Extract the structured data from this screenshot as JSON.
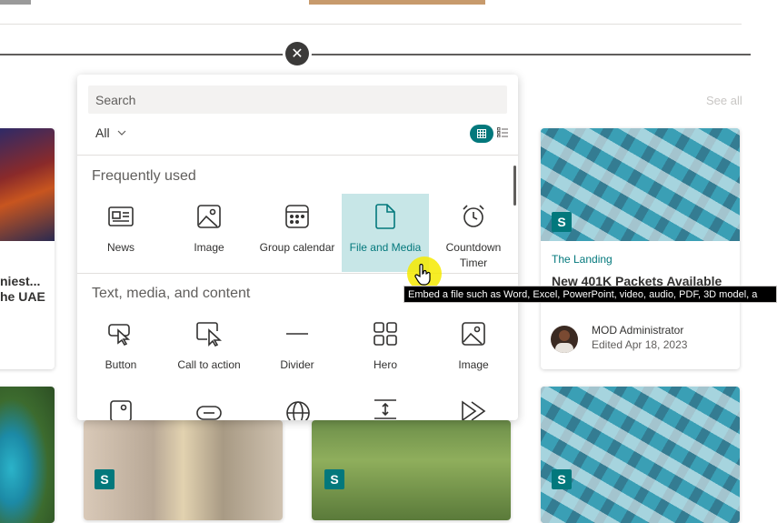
{
  "background": {
    "see_all": "See all",
    "cards": [
      {
        "title_line1": "niest...",
        "title_line2": "he UAE"
      },
      {
        "site": "The Landing",
        "title": "New 401K Packets Available",
        "author": "MOD Administrator",
        "edited": "Edited Apr 18, 2023"
      }
    ],
    "site_badge": "S"
  },
  "panel": {
    "search_placeholder": "Search",
    "filter_label": "All",
    "sections": [
      {
        "title": "Frequently used",
        "items": [
          {
            "label": "News",
            "icon": "news-icon"
          },
          {
            "label": "Image",
            "icon": "image-icon"
          },
          {
            "label": "Group calendar",
            "icon": "calendar-icon"
          },
          {
            "label": "File and Media",
            "icon": "file-icon",
            "selected": true
          },
          {
            "label_line1": "Countdown",
            "label_line2": "Timer",
            "icon": "alarm-clock-icon"
          }
        ]
      },
      {
        "title": "Text, media, and content",
        "items": [
          {
            "label": "Button",
            "icon": "button-pointer-icon"
          },
          {
            "label": "Call to action",
            "icon": "call-to-action-icon"
          },
          {
            "label": "Divider",
            "icon": "divider-icon"
          },
          {
            "label": "Hero",
            "icon": "hero-layout-icon"
          },
          {
            "label": "Image",
            "icon": "image-icon"
          }
        ]
      }
    ]
  },
  "tooltip": "Embed a file such as Word, Excel, PowerPoint, video, audio, PDF, 3D model, a",
  "colors": {
    "accent": "#03787c",
    "selected_bg": "#c7e6e7",
    "tooltip_bg": "#000000",
    "cursor_highlight": "#f6ea00"
  }
}
